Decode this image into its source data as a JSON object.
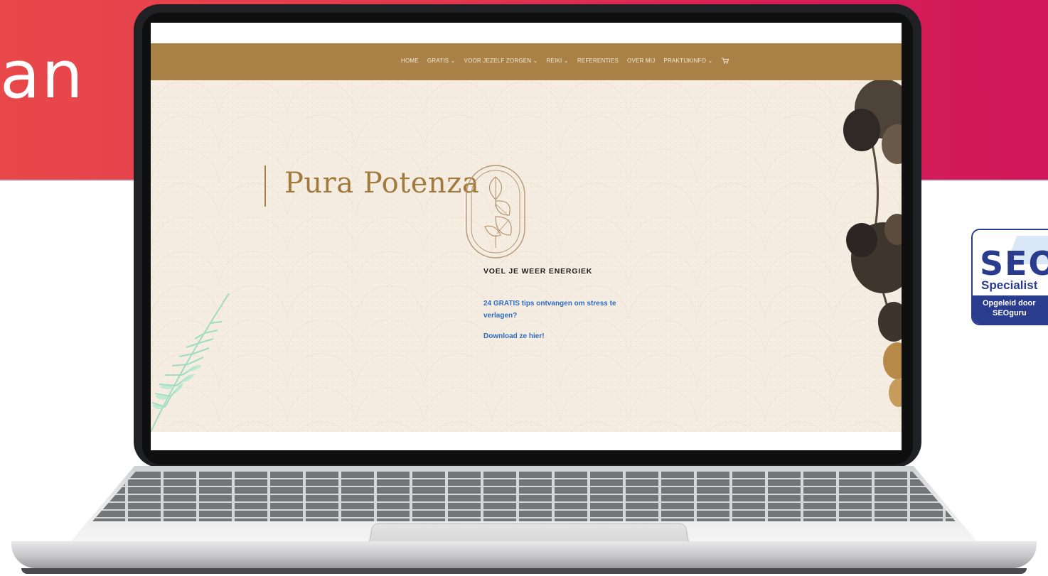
{
  "banner": {
    "partial_text": "an"
  },
  "seo_badge": {
    "logo_text": "SEO",
    "label": "Specialist",
    "line1": "Opgeleid door",
    "line2": "SEOguru"
  },
  "website": {
    "nav": {
      "items": [
        "HOME",
        "GRATIS ⌄",
        "VOOR JEZELF ZORGEN ⌄",
        "REIKI ⌄",
        "REFERENTIES",
        "OVER MIJ",
        "PRAKTIJKINFO ⌄"
      ],
      "cart_icon": "cart-icon"
    },
    "hero": {
      "brand": "Pura Potenza",
      "tagline": "VOEL JE WEER ENERGIEK",
      "promo_text": "24 GRATIS tips ontvangen om stress te verlagen?",
      "promo_link": "Download ze hier!"
    }
  },
  "colors": {
    "banner_start": "#e8484a",
    "banner_end": "#d0185a",
    "nav_bar": "#a98046",
    "hero_bg": "#f5ede1",
    "brand_text": "#a27a3e",
    "link_blue": "#2e6cc1",
    "seo_blue": "#2a3c8e"
  }
}
